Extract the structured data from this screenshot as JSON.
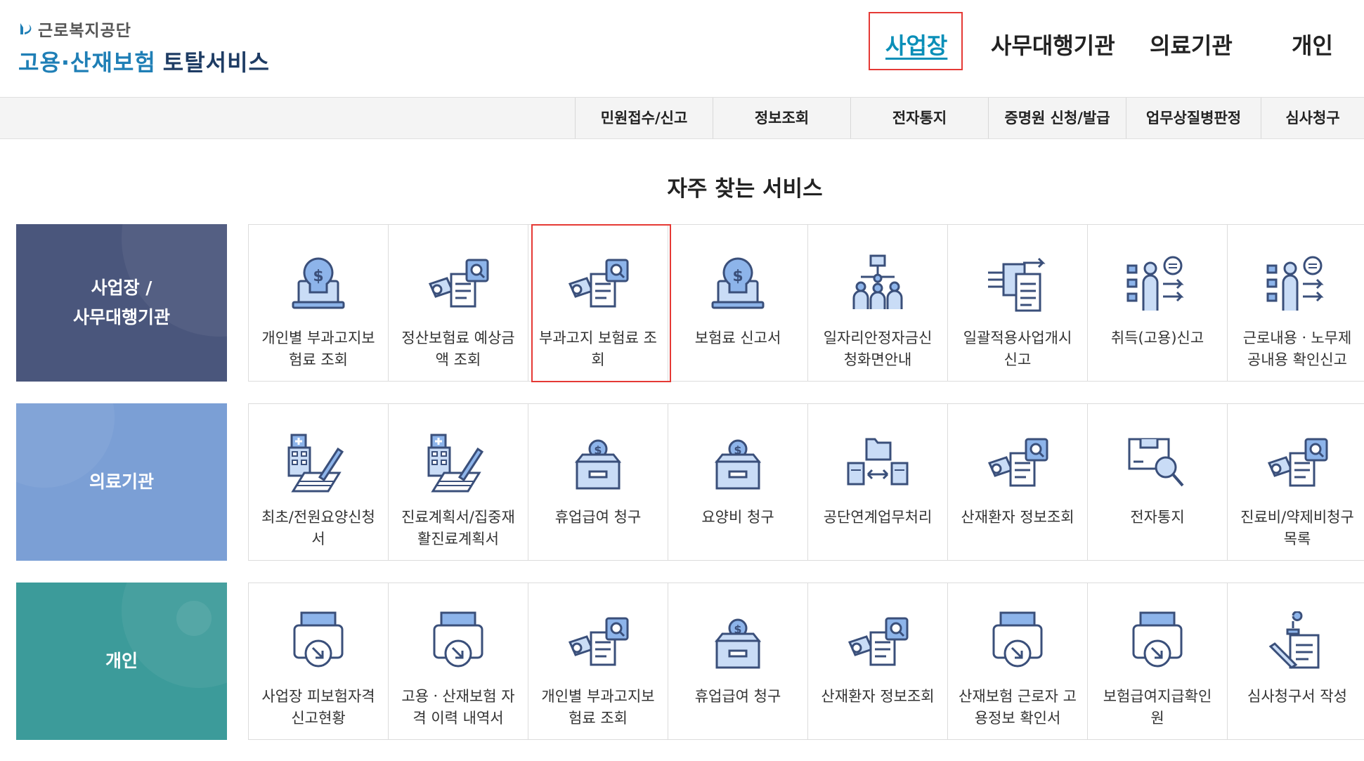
{
  "brand": {
    "org": "근로복지공단",
    "title_a": "고용·산재보험",
    "title_b": "토탈서비스",
    "colors": {
      "blue": "#1f7fb6",
      "navy": "#1e3c64"
    }
  },
  "top_nav": [
    {
      "label": "사업장",
      "active": true
    },
    {
      "label": "사무대행기관"
    },
    {
      "label": "의료기관"
    },
    {
      "label": "개인"
    }
  ],
  "sub_nav": [
    "민원접수/신고",
    "정보조회",
    "전자통지",
    "증명원 신청/발급",
    "업무상질병판정",
    "심사청구"
  ],
  "section_title": "자주 찾는 서비스",
  "rows": [
    {
      "category_line1": "사업장 /",
      "category_line2": "사무대행기관",
      "color": "#4a567c",
      "items": [
        {
          "icon": "money-bulb-laptop-icon",
          "l1": "개인별 부과고지보",
          "l2": "험료 조회"
        },
        {
          "icon": "document-search-icon",
          "l1": "정산보험료 예상금",
          "l2": "액 조회"
        },
        {
          "icon": "document-search-icon",
          "l1": "부과고지 보험료 조",
          "l2": "회"
        },
        {
          "icon": "money-bulb-laptop-icon",
          "l1": "보험료 신고서",
          "l2": ""
        },
        {
          "icon": "org-chart-people-icon",
          "l1": "일자리안정자금신",
          "l2": "청화면안내"
        },
        {
          "icon": "documents-transfer-icon",
          "l1": "일괄적용사업개시",
          "l2": "신고"
        },
        {
          "icon": "person-checklist-icon",
          "l1": "취득(고용)신고",
          "l2": ""
        },
        {
          "icon": "person-checklist-icon",
          "l1": "근로내용ㆍ노무제",
          "l2": "공내용 확인신고"
        }
      ]
    },
    {
      "category_line1": "의료기관",
      "category_line2": "",
      "color": "#7b9fd5",
      "items": [
        {
          "icon": "hospital-pen-icon",
          "l1": "최초/전원요양신청",
          "l2": "서"
        },
        {
          "icon": "hospital-pen-icon",
          "l1": "진료계획서/집중재",
          "l2": "활진료계획서"
        },
        {
          "icon": "coin-box-icon",
          "l1": "휴업급여 청구",
          "l2": ""
        },
        {
          "icon": "coin-box-icon",
          "l1": "요양비 청구",
          "l2": ""
        },
        {
          "icon": "folder-exchange-icon",
          "l1": "공단연계업무처리",
          "l2": ""
        },
        {
          "icon": "document-search-icon",
          "l1": "산재환자 정보조회",
          "l2": ""
        },
        {
          "icon": "notice-magnifier-icon",
          "l1": "전자통지",
          "l2": ""
        },
        {
          "icon": "document-search-icon",
          "l1": "진료비/약제비청구",
          "l2": "목록"
        }
      ]
    },
    {
      "category_line1": "개인",
      "category_line2": "",
      "color": "#3c9b9a",
      "items": [
        {
          "icon": "printer-download-icon",
          "l1": "사업장 피보험자격",
          "l2": "신고현황"
        },
        {
          "icon": "printer-download-icon",
          "l1": "고용ㆍ산재보험 자",
          "l2": "격 이력 내역서"
        },
        {
          "icon": "document-search-icon",
          "l1": "개인별 부과고지보",
          "l2": "험료 조회"
        },
        {
          "icon": "coin-box-icon",
          "l1": "휴업급여 청구",
          "l2": ""
        },
        {
          "icon": "document-search-icon",
          "l1": "산재환자 정보조회",
          "l2": ""
        },
        {
          "icon": "printer-download-icon",
          "l1": "산재보험 근로자 고",
          "l2": "용정보 확인서"
        },
        {
          "icon": "printer-download-icon",
          "l1": "보험급여지급확인",
          "l2": "원"
        },
        {
          "icon": "document-stamp-icon",
          "l1": "심사청구서 작성",
          "l2": ""
        }
      ]
    }
  ],
  "icon_colors": {
    "stroke": "#3a4f7a",
    "fill": "#8db4ea",
    "light": "#c9dcf6"
  }
}
